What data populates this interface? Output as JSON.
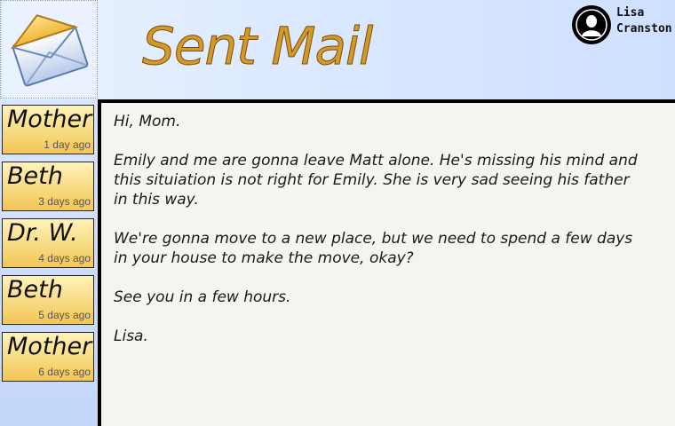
{
  "header": {
    "title": "Sent Mail",
    "user_name_line1": "Lisa",
    "user_name_line2": "Cranston"
  },
  "sidebar": {
    "items": [
      {
        "name": "Mother",
        "time": "1 day ago"
      },
      {
        "name": "Beth",
        "time": "3 days ago"
      },
      {
        "name": "Dr. W.",
        "time": "4 days ago"
      },
      {
        "name": "Beth",
        "time": "5 days ago"
      },
      {
        "name": "Mother",
        "time": "6 days ago"
      }
    ]
  },
  "message": {
    "paragraphs": [
      "Hi, Mom.",
      "Emily and me are gonna leave Matt alone. He's missing his mind and this situiation is not right for Emily. She is very sad seeing his father in this way.",
      "We're gonna move to a new place, but we need to spend a few days in your house to make the move, okay?",
      "See you in a few hours.",
      "Lisa."
    ]
  },
  "colors": {
    "title": "#d49a28",
    "contact_card_top": "#fff2b8",
    "contact_card_bottom": "#f3c655",
    "message_bg": "#f5f4ee"
  },
  "icons": {
    "app": "envelope-icon",
    "user": "user-silhouette-icon"
  }
}
